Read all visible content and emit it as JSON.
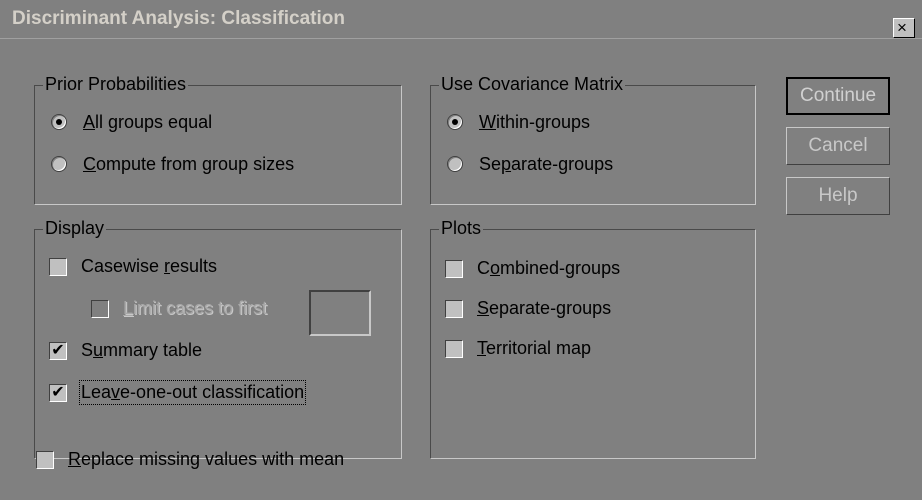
{
  "window": {
    "title": "Discriminant Analysis: Classification",
    "close_label": "×"
  },
  "prior_probabilities": {
    "title": "Prior Probabilities",
    "options": [
      {
        "pre": "",
        "u": "A",
        "post": "ll groups equal",
        "selected": true
      },
      {
        "pre": "",
        "u": "C",
        "post": "ompute from group sizes",
        "selected": false
      }
    ]
  },
  "covariance": {
    "title": "Use Covariance Matrix",
    "options": [
      {
        "pre": "",
        "u": "W",
        "post": "ithin-groups",
        "selected": true
      },
      {
        "pre": "Se",
        "u": "p",
        "post": "arate-groups",
        "selected": false
      }
    ]
  },
  "display": {
    "title": "Display",
    "casewise": {
      "pre": "Casewise ",
      "u": "r",
      "post": "esults",
      "checked": false
    },
    "limit": {
      "pre": "",
      "u": "L",
      "post": "imit cases to first",
      "checked": false,
      "enabled": false,
      "value": ""
    },
    "summary": {
      "pre": "S",
      "u": "u",
      "post": "mmary table",
      "checked": true
    },
    "leave_one_out": {
      "pre": "Lea",
      "u": "v",
      "post": "e-one-out classification",
      "checked": true
    }
  },
  "plots": {
    "title": "Plots",
    "items": [
      {
        "pre": "C",
        "u": "o",
        "post": "mbined-groups",
        "checked": false
      },
      {
        "pre": "",
        "u": "S",
        "post": "eparate-groups",
        "checked": false
      },
      {
        "pre": "",
        "u": "T",
        "post": "erritorial map",
        "checked": false
      }
    ]
  },
  "replace_missing": {
    "pre": "",
    "u": "R",
    "post": "eplace missing values with mean",
    "checked": false
  },
  "buttons": {
    "continue": "Continue",
    "cancel": "Cancel",
    "help": "Help"
  },
  "check_mark": "✔"
}
